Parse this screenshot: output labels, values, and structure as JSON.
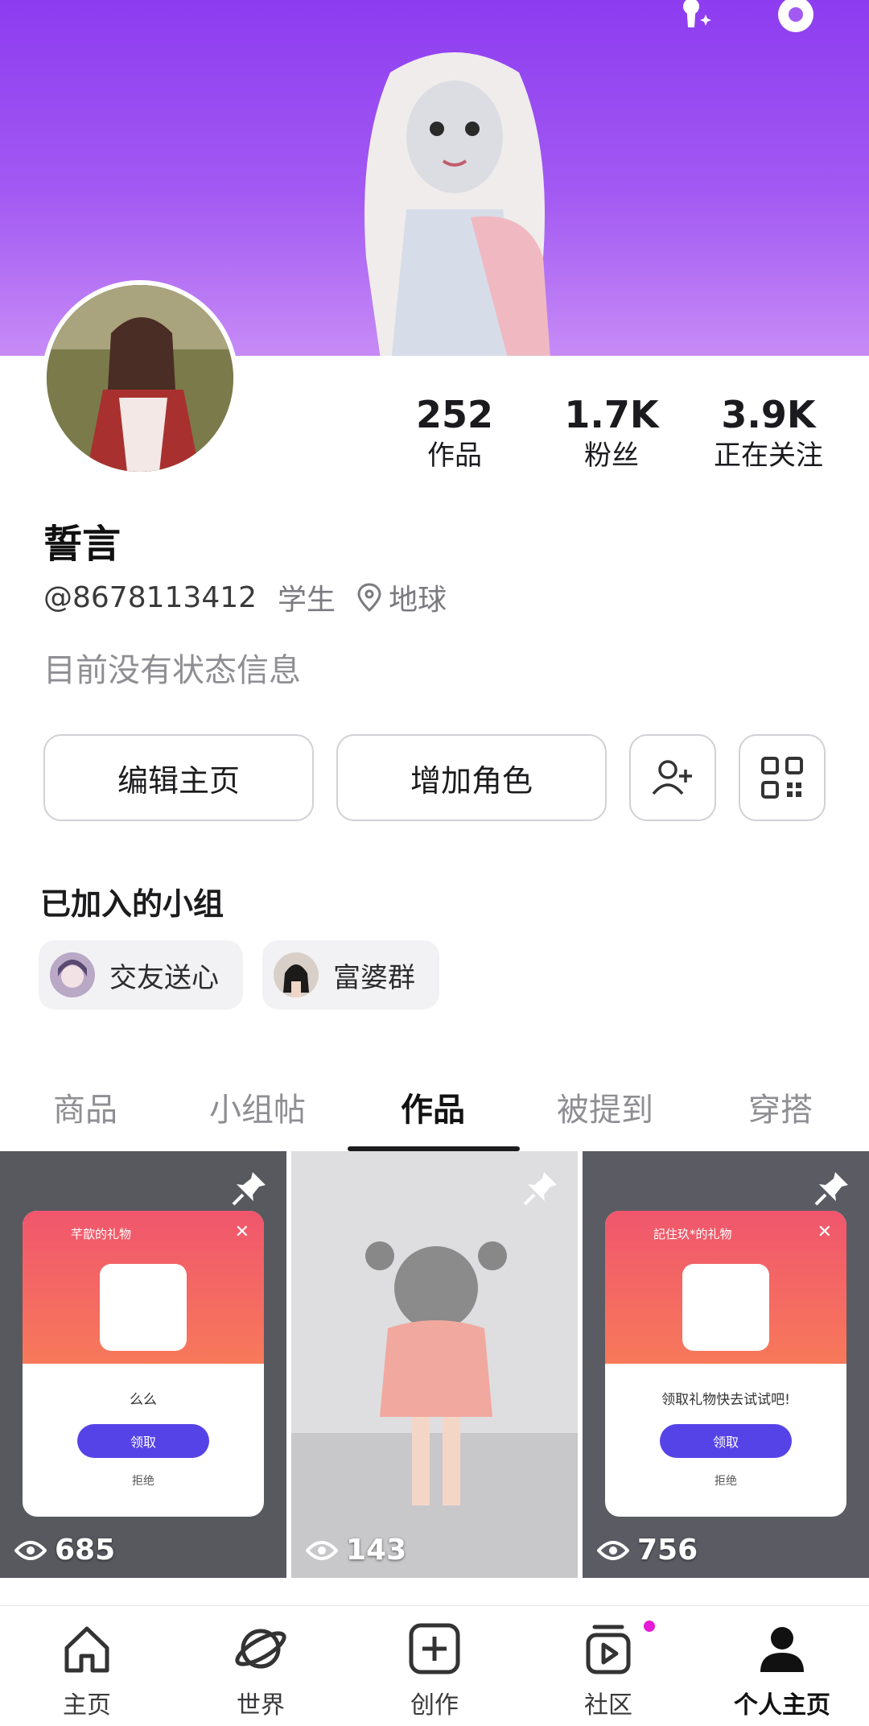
{
  "profile": {
    "name": "誓言",
    "handle": "@8678113412",
    "occupation": "学生",
    "location": "地球",
    "status": "目前没有状态信息"
  },
  "stats": [
    {
      "value": "252",
      "label": "作品"
    },
    {
      "value": "1.7K",
      "label": "粉丝"
    },
    {
      "value": "3.9K",
      "label": "正在关注"
    }
  ],
  "actions": {
    "edit_label": "编辑主页",
    "add_role_label": "增加角色",
    "add_friend_icon": "person-plus-icon",
    "qr_icon": "qr-code-icon"
  },
  "groups": {
    "title": "已加入的小组",
    "items": [
      {
        "name": "交友送心"
      },
      {
        "name": "富婆群"
      }
    ]
  },
  "tabs": [
    {
      "label": "商品"
    },
    {
      "label": "小组帖"
    },
    {
      "label": "作品",
      "active": true
    },
    {
      "label": "被提到"
    },
    {
      "label": "穿搭"
    }
  ],
  "posts": [
    {
      "views": "685",
      "popup_title": "芊歆的礼物",
      "popup_msg": "么么",
      "accept": "领取",
      "refuse": "拒绝"
    },
    {
      "views": "143"
    },
    {
      "views": "756",
      "popup_title": "記住玖*的礼物",
      "popup_msg": "领取礼物快去试试吧!",
      "accept": "领取",
      "refuse": "拒绝"
    }
  ],
  "nav": [
    {
      "label": "主页",
      "icon": "home-icon"
    },
    {
      "label": "世界",
      "icon": "planet-icon"
    },
    {
      "label": "创作",
      "icon": "plus-square-icon"
    },
    {
      "label": "社区",
      "icon": "community-icon"
    },
    {
      "label": "个人主页",
      "icon": "person-icon",
      "active": true
    }
  ],
  "colors": {
    "banner_top": "#8d3cf0",
    "banner_bottom": "#c78bf6",
    "accent_button": "#5643e8",
    "notification_dot": "#e61bd8"
  }
}
